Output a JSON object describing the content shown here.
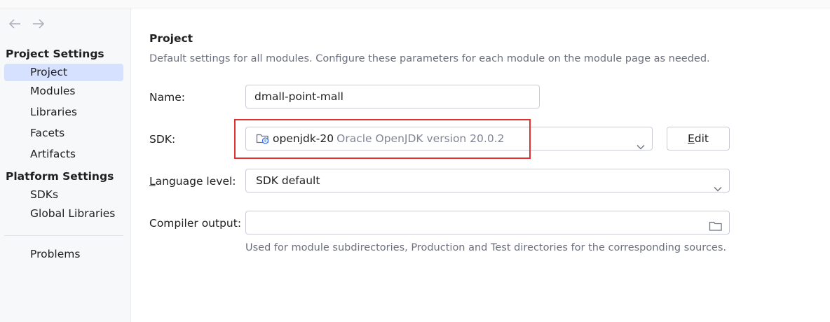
{
  "sidebar": {
    "project_settings_title": "Project Settings",
    "project_items": [
      {
        "label": "Project",
        "selected": true
      },
      {
        "label": "Modules"
      },
      {
        "label": "Libraries"
      },
      {
        "label": "Facets"
      },
      {
        "label": "Artifacts"
      }
    ],
    "platform_settings_title": "Platform Settings",
    "platform_items": [
      {
        "label": "SDKs"
      },
      {
        "label": "Global Libraries"
      }
    ],
    "problems_label": "Problems"
  },
  "main": {
    "title": "Project",
    "description": "Default settings for all modules. Configure these parameters for each module on the module page as needed.",
    "name_label": "Name:",
    "name_value": "dmall-point-mall",
    "sdk_label": "SDK:",
    "sdk_name": "openjdk-20",
    "sdk_version": "Oracle OpenJDK version 20.0.2",
    "edit_button": {
      "prefix": "",
      "mnemonic": "E",
      "rest": "dit"
    },
    "language_label": {
      "mnemonic": "L",
      "rest": "anguage level:"
    },
    "language_value": "SDK default",
    "compiler_label": "Compiler output:",
    "compiler_value": "",
    "compiler_hint": "Used for module subdirectories, Production and Test directories for the corresponding sources."
  },
  "colors": {
    "selection": "#d5e1ff",
    "highlight_box": "#e03030",
    "hint_text": "#6c707e"
  }
}
